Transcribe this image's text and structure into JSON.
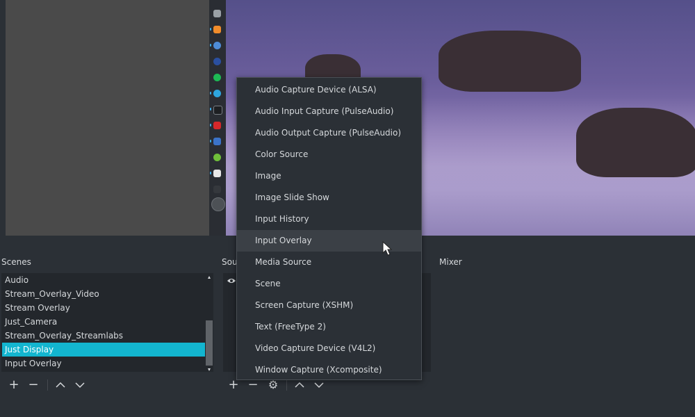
{
  "panels": {
    "scenes_title": "Scenes",
    "sources_title": "Sou",
    "mixer_title": "Mixer"
  },
  "scenes": {
    "items": [
      {
        "label": "Audio",
        "selected": false
      },
      {
        "label": "Stream_Overlay_Video",
        "selected": false
      },
      {
        "label": "Stream Overlay",
        "selected": false
      },
      {
        "label": "Just_Camera",
        "selected": false
      },
      {
        "label": "Stream_Overlay_Streamlabs",
        "selected": false
      },
      {
        "label": "Just Display",
        "selected": true
      },
      {
        "label": "Input Overlay",
        "selected": false
      }
    ],
    "selected_color": "#13b5cf"
  },
  "toolbar": {
    "add": "+",
    "remove": "−",
    "up": "︿",
    "down": "﹀",
    "settings": "⚙"
  },
  "menu": {
    "items": [
      {
        "label": "Audio Capture Device (ALSA)"
      },
      {
        "label": "Audio Input Capture (PulseAudio)"
      },
      {
        "label": "Audio Output Capture (PulseAudio)"
      },
      {
        "label": "Color Source"
      },
      {
        "label": "Image"
      },
      {
        "label": "Image Slide Show"
      },
      {
        "label": "Input History"
      },
      {
        "label": "Input Overlay",
        "hovered": true
      },
      {
        "label": "Media Source"
      },
      {
        "label": "Scene"
      },
      {
        "label": "Screen Capture (XSHM)"
      },
      {
        "label": "Text (FreeType 2)"
      },
      {
        "label": "Video Capture Device (V4L2)"
      },
      {
        "label": "Window Capture (Xcomposite)"
      }
    ]
  },
  "dock_icons": [
    "monitor-icon",
    "rss-icon",
    "chat-icon",
    "browser-icon",
    "spotify-icon",
    "telegram-icon",
    "terminal-icon",
    "vivaldi-icon",
    "vscode-icon",
    "keepass-icon",
    "document-icon",
    "blank-icon",
    "obs-icon"
  ],
  "colors": {
    "background": "#2b3036",
    "list_bg": "#23272c",
    "accent": "#13b5cf"
  }
}
